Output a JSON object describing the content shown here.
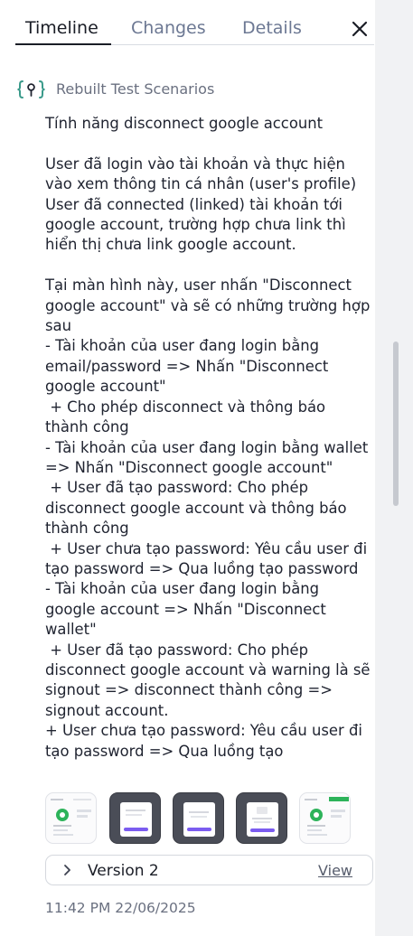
{
  "tabs": [
    {
      "label": "Timeline",
      "active": true
    },
    {
      "label": "Changes",
      "active": false
    },
    {
      "label": "Details",
      "active": false
    }
  ],
  "close_icon": "close-icon",
  "source": {
    "icon": "scenario-key-icon",
    "label": "Rebuilt Test Scenarios"
  },
  "description": "Tính năng disconnect google account\n\nUser đã login vào tài khoản và thực hiện vào xem thông tin cá nhân (user's profile)\nUser đã connected (linked) tài khoản tới google account, trường hợp chưa link thì hiển thị chưa link google account.\n\nTại màn hình này, user nhấn \"Disconnect google account\" và sẽ có những trường hợp sau\n- Tài khoản của user đang login bằng email/password => Nhấn \"Disconnect google account\"\n + Cho phép disconnect và thông báo thành công\n- Tài khoản của user đang login bằng wallet => Nhấn \"Disconnect google account\"\n + User đã tạo password: Cho phép disconnect google account và thông báo thành công\n + User chưa tạo password: Yêu cầu user đi tạo password => Qua luồng tạo password\n- Tài khoản của user đang login bằng google account => Nhấn \"Disconnect wallet\"\n + User đã tạo password: Cho phép disconnect google account và warning là sẽ signout => disconnect thành công => signout account.\n+ User chưa tạo password: Yêu cầu user đi tạo password => Qua luồng tạo",
  "thumbnails": [
    {
      "style": "light",
      "kind": "profile-screen"
    },
    {
      "style": "dark",
      "kind": "modal-screen"
    },
    {
      "style": "dark",
      "kind": "modal-screen"
    },
    {
      "style": "dark",
      "kind": "modal-screen"
    },
    {
      "style": "light",
      "kind": "profile-screen-green"
    }
  ],
  "version": {
    "chevron_icon": "chevron-right-icon",
    "label": "Version 2",
    "action": "View"
  },
  "timestamp": "11:42 PM 22/06/2025",
  "colors": {
    "text": "#1f2330",
    "muted": "#6c7893",
    "accent_green": "#2db35a",
    "accent_purple": "#7b5cf0",
    "icon_teal": "#3a9a8a"
  }
}
